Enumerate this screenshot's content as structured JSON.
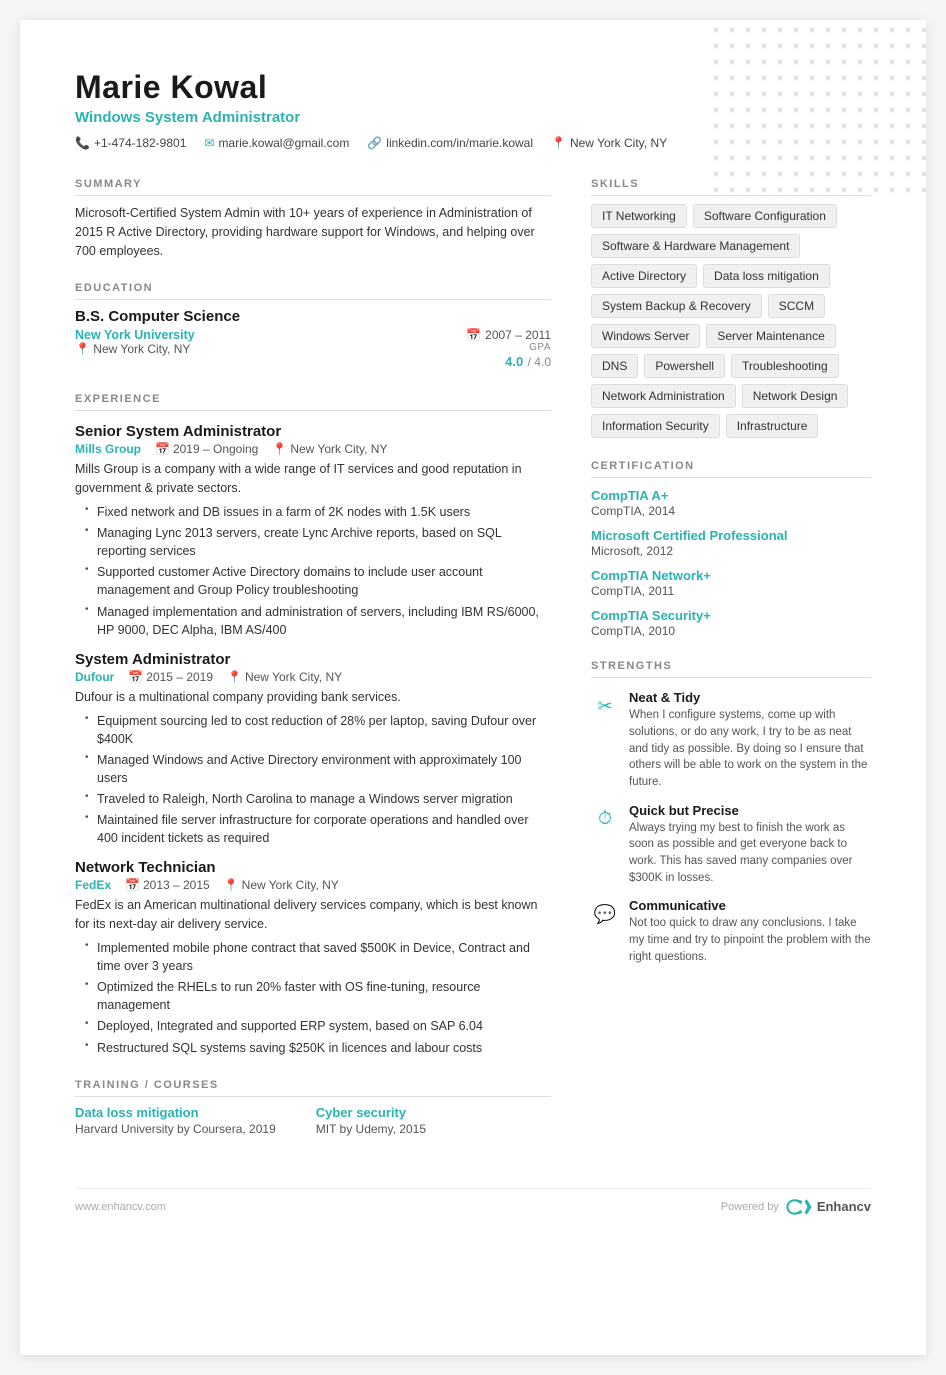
{
  "header": {
    "name": "Marie Kowal",
    "title": "Windows System Administrator",
    "phone": "+1-474-182-9801",
    "email": "marie.kowal@gmail.com",
    "linkedin": "linkedin.com/in/marie.kowal",
    "location": "New York City, NY"
  },
  "summary": {
    "title": "SUMMARY",
    "text": "Microsoft-Certified System Admin with 10+ years of experience in Administration of 2015 R Active Directory, providing hardware support for Windows, and helping over 700 employees."
  },
  "education": {
    "title": "EDUCATION",
    "degree": "B.S. Computer Science",
    "school": "New York University",
    "location": "New York City, NY",
    "dates": "2007 – 2011",
    "gpa_label": "GPA",
    "gpa_value": "4.0",
    "gpa_max": "/ 4.0"
  },
  "experience": {
    "title": "EXPERIENCE",
    "jobs": [
      {
        "title": "Senior System Administrator",
        "company": "Mills Group",
        "dates": "2019 – Ongoing",
        "location": "New York City, NY",
        "description": "Mills Group is a company with a wide range of IT services and good reputation in government & private sectors.",
        "bullets": [
          "Fixed network and DB issues in a farm of 2K nodes with 1.5K users",
          "Managing Lync 2013 servers, create Lync Archive reports, based on SQL reporting services",
          "Supported customer Active Directory domains to include user account management and Group Policy troubleshooting",
          "Managed implementation and administration of servers, including IBM RS/6000, HP 9000, DEC Alpha, IBM AS/400"
        ]
      },
      {
        "title": "System Administrator",
        "company": "Dufour",
        "dates": "2015 – 2019",
        "location": "New York City, NY",
        "description": "Dufour is a multinational company providing bank services.",
        "bullets": [
          "Equipment sourcing led to cost reduction of 28% per laptop, saving Dufour over $400K",
          "Managed Windows and Active Directory environment with approximately 100 users",
          "Traveled to Raleigh, North Carolina to manage a Windows server migration",
          "Maintained file server infrastructure for corporate operations and handled over 400 incident tickets as required"
        ]
      },
      {
        "title": "Network Technician",
        "company": "FedEx",
        "dates": "2013 – 2015",
        "location": "New York City, NY",
        "description": "FedEx is an American multinational delivery services company, which is best known for its next-day air delivery service.",
        "bullets": [
          "Implemented mobile phone contract that saved $500K in Device, Contract and time over 3 years",
          "Optimized the RHELs to run 20% faster with OS fine-tuning, resource management",
          "Deployed, Integrated and supported ERP system, based on SAP 6.04",
          "Restructured SQL systems saving $250K in licences and labour costs"
        ]
      }
    ]
  },
  "training": {
    "title": "TRAINING / COURSES",
    "items": [
      {
        "name": "Data loss mitigation",
        "org": "Harvard University by Coursera, 2019"
      },
      {
        "name": "Cyber security",
        "org": "MIT by Udemy, 2015"
      }
    ]
  },
  "skills": {
    "title": "SKILLS",
    "items": [
      "IT Networking",
      "Software Configuration",
      "Software & Hardware Management",
      "Active Directory",
      "Data loss mitigation",
      "System Backup & Recovery",
      "SCCM",
      "Windows Server",
      "Server Maintenance",
      "DNS",
      "Powershell",
      "Troubleshooting",
      "Network Administration",
      "Network Design",
      "Information Security",
      "Infrastructure"
    ]
  },
  "certification": {
    "title": "CERTIFICATION",
    "items": [
      {
        "name": "CompTIA A+",
        "issuer": "CompTIA, 2014"
      },
      {
        "name": "Microsoft Certified Professional",
        "issuer": "Microsoft, 2012"
      },
      {
        "name": "CompTIA Network+",
        "issuer": "CompTIA, 2011"
      },
      {
        "name": "CompTIA Security+",
        "issuer": "CompTIA, 2010"
      }
    ]
  },
  "strengths": {
    "title": "STRENGTHS",
    "items": [
      {
        "icon": "✂",
        "title": "Neat & Tidy",
        "desc": "When I configure systems, come up with solutions, or do any work, I try to be as neat and tidy as possible. By doing so I ensure that others will be able to work on the system in the future."
      },
      {
        "icon": "⏱",
        "title": "Quick but Precise",
        "desc": "Always trying my best to finish the work as soon as possible and get everyone back to work. This has saved many companies over $300K in losses."
      },
      {
        "icon": "💬",
        "title": "Communicative",
        "desc": "Not too quick to draw any conclusions. I take my time and try to pinpoint the problem with the right questions."
      }
    ]
  },
  "footer": {
    "website": "www.enhancv.com",
    "powered_by": "Powered by",
    "brand": "Enhancv"
  }
}
